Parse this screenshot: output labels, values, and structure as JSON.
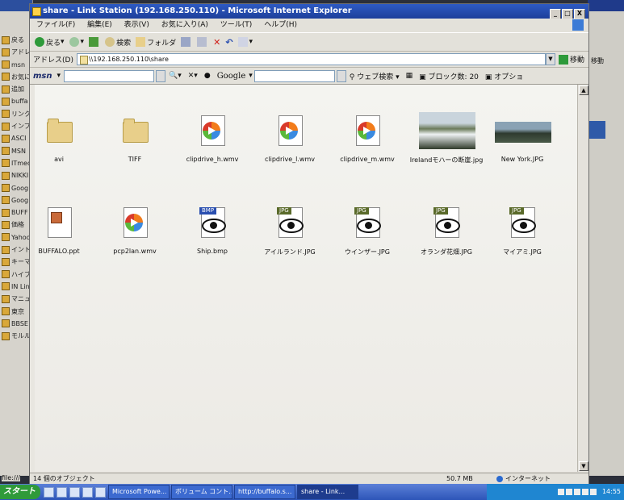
{
  "window": {
    "title": "share - Link Station (192.168.250.110) - Microsoft Internet Explorer",
    "controls": [
      "_",
      "□",
      "X"
    ]
  },
  "menu": [
    "ファイル(F)",
    "編集(E)",
    "表示(V)",
    "お気に入り(A)",
    "ツール(T)",
    "ヘルプ(H)"
  ],
  "toolbar": {
    "back_label": "戻る",
    "search_label": "検索",
    "folders_label": "フォルダ"
  },
  "address": {
    "label": "アドレス(D)",
    "value": "\\\\192.168.250.110\\share",
    "go_label": "移動"
  },
  "msn": {
    "logo": "msn",
    "google_label": "Google",
    "web_search_label": "ウェブ検索",
    "blocked_label": "ブロック数: 20",
    "options_label": "オプショ"
  },
  "files": [
    {
      "name": "avi",
      "type": "folder"
    },
    {
      "name": "TIFF",
      "type": "folder"
    },
    {
      "name": "clipdrive_h.wmv",
      "type": "wmv"
    },
    {
      "name": "clipdrive_l.wmv",
      "type": "wmv"
    },
    {
      "name": "clipdrive_m.wmv",
      "type": "wmv"
    },
    {
      "name": "Irelandモハーの断崖.jpg",
      "type": "thumb-cliff"
    },
    {
      "name": "New York.JPG",
      "type": "thumb-city"
    },
    {
      "name": "BUFFALO.ppt",
      "type": "ppt"
    },
    {
      "name": "pcp2lan.wmv",
      "type": "wmv"
    },
    {
      "name": "Ship.bmp",
      "type": "bmp"
    },
    {
      "name": "アイルランド.JPG",
      "type": "jpg"
    },
    {
      "name": "ウインザー.JPG",
      "type": "jpg"
    },
    {
      "name": "オランダ花畑.JPG",
      "type": "jpg"
    },
    {
      "name": "マイアミ.JPG",
      "type": "jpg"
    }
  ],
  "badges": {
    "bmp": "BMP",
    "jpg": "JPG"
  },
  "status": {
    "objects": "14 個のオブジェクト",
    "size": "50.7 MB",
    "zone": "インターネット"
  },
  "left_window": {
    "items": [
      "戻る",
      "アドレス",
      "msn",
      "お気に入り",
      "追加",
      "buffa",
      "リンク",
      "インプ",
      "ASCI",
      "MSN",
      "ITmed",
      "NIKKI",
      "Goog",
      "Goog",
      "BUFF",
      "価格",
      "Yahoo",
      "イント",
      "キーマ",
      "ハイブ",
      "IN Lin",
      "マニュ",
      "東京",
      "BBSE",
      "モルル"
    ],
    "status": "file:///"
  },
  "right_window": {
    "go_label": "移動"
  },
  "taskbar": {
    "start": "スタート",
    "tasks": [
      "Microsoft Powe...",
      "ボリューム コント...",
      "http://buffalo.s...",
      "share - Link..."
    ],
    "clock": "14:55"
  },
  "colors": {
    "titlebar": "#2e5bc4",
    "taskbar": "#2d55b8",
    "start": "#2f9a3a"
  }
}
